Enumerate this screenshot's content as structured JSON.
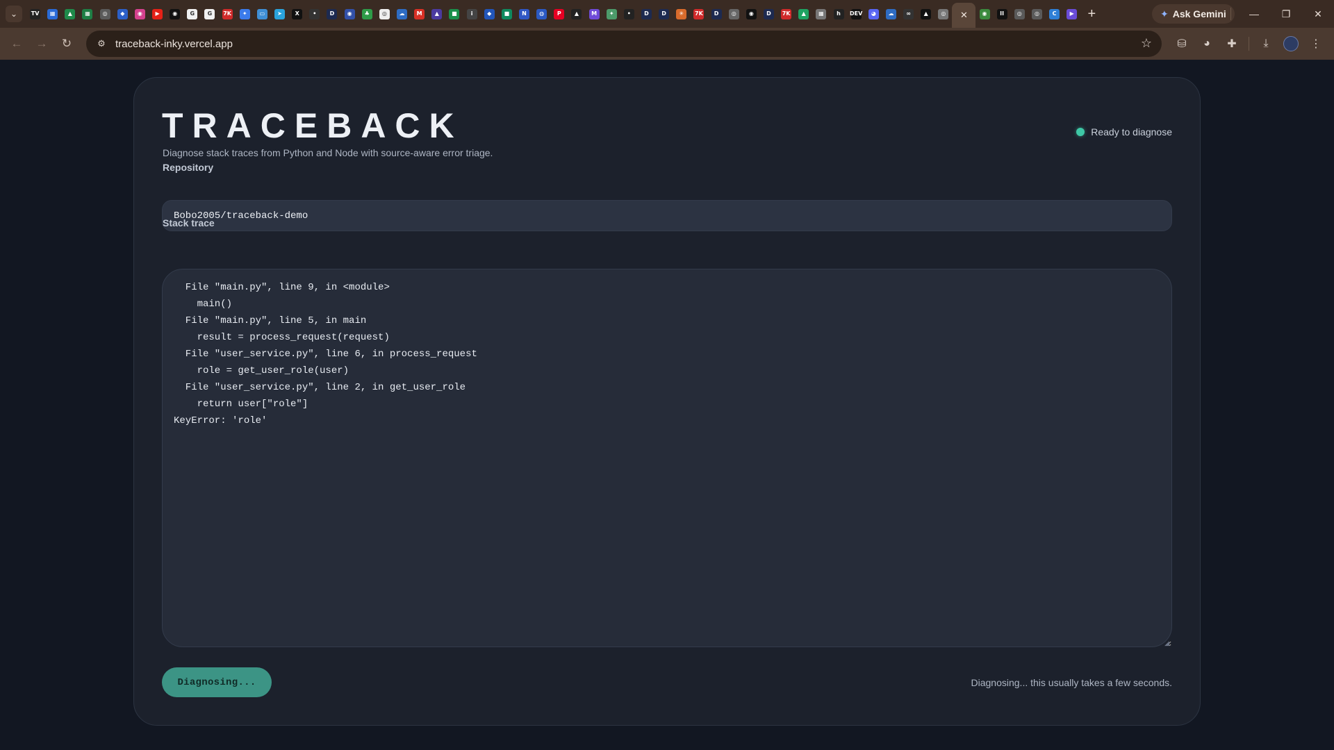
{
  "browser": {
    "pinned_tabs": [
      {
        "icon": "tab-icon-tv",
        "glyph": "TV",
        "color": "#222222"
      },
      {
        "icon": "tab-icon-sheet",
        "glyph": "▦",
        "color": "#2a6ad6"
      },
      {
        "icon": "tab-icon-chart",
        "glyph": "▲",
        "color": "#1f8a4a"
      },
      {
        "icon": "tab-icon-sheets",
        "glyph": "▦",
        "color": "#1e7e45"
      },
      {
        "icon": "tab-icon-globe",
        "glyph": "◎",
        "color": "#5a5a5a"
      },
      {
        "icon": "tab-icon-shield",
        "glyph": "◆",
        "color": "#2c5fc7"
      },
      {
        "icon": "tab-icon-circle",
        "glyph": "◉",
        "color": "#d4418e"
      },
      {
        "icon": "tab-icon-youtube",
        "glyph": "▶",
        "color": "#e62117"
      },
      {
        "icon": "tab-icon-github",
        "glyph": "◉",
        "color": "#111111"
      },
      {
        "icon": "tab-icon-google",
        "glyph": "G",
        "color": "#f1f1f1"
      },
      {
        "icon": "tab-icon-google",
        "glyph": "G",
        "color": "#f1f1f1"
      },
      {
        "icon": "tab-icon-news",
        "glyph": "7K",
        "color": "#d02a2a"
      },
      {
        "icon": "tab-icon-copilot",
        "glyph": "✦",
        "color": "#3b7bea"
      },
      {
        "icon": "tab-icon-monitor",
        "glyph": "▭",
        "color": "#3f8fd6"
      },
      {
        "icon": "tab-icon-telegram",
        "glyph": "➤",
        "color": "#2aa3dc"
      },
      {
        "icon": "tab-icon-x",
        "glyph": "X",
        "color": "#111111"
      },
      {
        "icon": "tab-icon-dot",
        "glyph": "•",
        "color": "#333333"
      },
      {
        "icon": "tab-icon-d",
        "glyph": "D",
        "color": "#1d2a50"
      },
      {
        "icon": "tab-icon-circle-blue",
        "glyph": "◉",
        "color": "#3250a8"
      },
      {
        "icon": "tab-icon-figure",
        "glyph": "♣",
        "color": "#2e9b48"
      },
      {
        "icon": "tab-icon-ring",
        "glyph": "◎",
        "color": "#eeeeee"
      },
      {
        "icon": "tab-icon-cloud",
        "glyph": "☁",
        "color": "#2e6cc3"
      },
      {
        "icon": "tab-icon-gmail",
        "glyph": "M",
        "color": "#d93025"
      },
      {
        "icon": "tab-icon-delta",
        "glyph": "▲",
        "color": "#4b3aa0"
      },
      {
        "icon": "tab-icon-square-green",
        "glyph": "■",
        "color": "#1a8f4b"
      },
      {
        "icon": "tab-icon-info",
        "glyph": "i",
        "color": "#444444"
      },
      {
        "icon": "tab-icon-shield-blue",
        "glyph": "◆",
        "color": "#2255b8"
      },
      {
        "icon": "tab-icon-green-box",
        "glyph": "■",
        "color": "#0f8a5f"
      },
      {
        "icon": "tab-icon-n",
        "glyph": "N",
        "color": "#3057c4"
      },
      {
        "icon": "tab-icon-globe-blue",
        "glyph": "◍",
        "color": "#2b59c3"
      },
      {
        "icon": "tab-icon-pinterest",
        "glyph": "P",
        "color": "#e60023"
      },
      {
        "icon": "tab-icon-triangle",
        "glyph": "▲",
        "color": "#222222"
      },
      {
        "icon": "tab-icon-m",
        "glyph": "M",
        "color": "#6f4bd8"
      },
      {
        "icon": "tab-icon-sparkle",
        "glyph": "✦",
        "color": "#4c9a6a"
      },
      {
        "icon": "tab-icon-dots",
        "glyph": "•",
        "color": "#222222"
      },
      {
        "icon": "tab-icon-d",
        "glyph": "D",
        "color": "#1d2a50"
      },
      {
        "icon": "tab-icon-d",
        "glyph": "D",
        "color": "#1d2a50"
      },
      {
        "icon": "tab-icon-asterisk",
        "glyph": "✳",
        "color": "#d96b2c"
      },
      {
        "icon": "tab-icon-news",
        "glyph": "7K",
        "color": "#d02a2a"
      },
      {
        "icon": "tab-icon-d",
        "glyph": "D",
        "color": "#1d2a50"
      },
      {
        "icon": "tab-icon-ring",
        "glyph": "◎",
        "color": "#666666"
      },
      {
        "icon": "tab-icon-github",
        "glyph": "◉",
        "color": "#111111"
      },
      {
        "icon": "tab-icon-d",
        "glyph": "D",
        "color": "#1d2a50"
      },
      {
        "icon": "tab-icon-news",
        "glyph": "7K",
        "color": "#d02a2a"
      },
      {
        "icon": "tab-icon-drive",
        "glyph": "▲",
        "color": "#1ea362"
      },
      {
        "icon": "tab-icon-grid",
        "glyph": "▦",
        "color": "#777777"
      },
      {
        "icon": "tab-icon-h",
        "glyph": "h",
        "color": "#222222"
      },
      {
        "icon": "tab-icon-dev",
        "glyph": "DEV",
        "color": "#111111"
      },
      {
        "icon": "tab-icon-discord",
        "glyph": "◕",
        "color": "#5865f2"
      },
      {
        "icon": "tab-icon-cloud",
        "glyph": "☁",
        "color": "#2e6cc3"
      },
      {
        "icon": "tab-icon-link",
        "glyph": "∞",
        "color": "#333333"
      },
      {
        "icon": "tab-icon-triangle",
        "glyph": "▲",
        "color": "#111111"
      },
      {
        "icon": "tab-icon-ring",
        "glyph": "◎",
        "color": "#777777"
      }
    ],
    "after_tabs": [
      {
        "icon": "tab-icon-chrome",
        "glyph": "◉",
        "color": "#3b8a3e"
      },
      {
        "icon": "tab-icon-pause",
        "glyph": "II",
        "color": "#111111"
      },
      {
        "icon": "tab-icon-globe",
        "glyph": "◎",
        "color": "#5a5a5a"
      },
      {
        "icon": "tab-icon-globe",
        "glyph": "◎",
        "color": "#5a5a5a"
      },
      {
        "icon": "tab-icon-c",
        "glyph": "C",
        "color": "#2e7fd6"
      },
      {
        "icon": "tab-icon-video",
        "glyph": "▶",
        "color": "#6a4cd8"
      }
    ],
    "active_tab_close": "✕",
    "new_tab": "+",
    "gemini_label": "Ask Gemini",
    "url": "traceback-inky.vercel.app",
    "window_min": "—",
    "window_restore": "❐",
    "window_close": "✕"
  },
  "app": {
    "title": "TRACEBACK",
    "subtitle": "Diagnose stack traces from Python and Node with source-aware error triage.",
    "status": "Ready to diagnose",
    "repo_label": "Repository",
    "repo_value": "Bobo2005/traceback-demo",
    "trace_label": "Stack trace",
    "trace_value": "  File \"main.py\", line 9, in <module>\n    main()\n  File \"main.py\", line 5, in main\n    result = process_request(request)\n  File \"user_service.py\", line 6, in process_request\n    role = get_user_role(user)\n  File \"user_service.py\", line 2, in get_user_role\n    return user[\"role\"]\nKeyError: 'role'",
    "button_label": "Diagnosing...",
    "footnote": "Diagnosing... this usually takes a few seconds.",
    "accent": "#3c9485",
    "status_color": "#3ec8a6"
  }
}
